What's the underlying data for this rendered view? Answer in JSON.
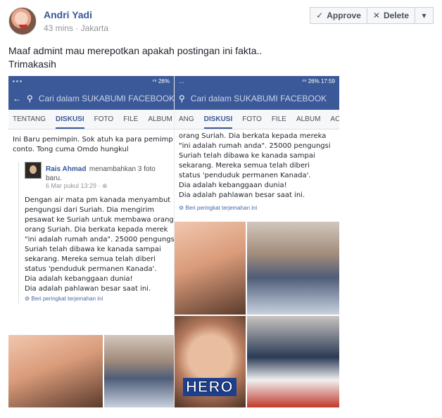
{
  "post": {
    "author": "Andri Yadi",
    "meta": "43 mins · Jakarta",
    "text_line1": "Maaf admint mau merepotkan apakah postingan ini fakta..",
    "text_line2": "Trimakasih"
  },
  "actions": {
    "approve_label": "Approve",
    "delete_label": "Delete"
  },
  "screenshot_left": {
    "status_right": "⁴⁶ 26%",
    "search_placeholder": "Cari dalam SUKABUMI FACEBOOK",
    "tabs": [
      "TENTANG",
      "DISKUSI",
      "FOTO",
      "FILE",
      "ALBUM"
    ],
    "body_line1": "Ini Baru pemimpin. Sok atuh ka para pemimp",
    "body_line2": "conto. Tong cuma Omdo hungkul",
    "sharer_name": "Rais Ahmad",
    "sharer_action": "menambahkan 3 foto",
    "sharer_action2": "baru.",
    "sharer_time": "6 Mar pukul 13:29 · ⊕",
    "quote": [
      "Dengan air mata pm kanada menyambut",
      "pengungsi dari Suriah. Dia mengirim",
      "pesawat ke Suriah untuk membawa orang",
      "orang Suriah. Dia berkata kepada merek",
      "\"ini adalah rumah anda\". 25000 pengungs",
      "Suriah telah dibawa ke kanada sampai",
      "sekarang. Mereka semua telah diberi",
      "status 'penduduk permanen Kanada'.",
      "Dia adalah kebanggaan dunia!",
      "Dia adalah pahlawan besar saat ini."
    ],
    "rate_text": "Beri peringkat terjemahan ini"
  },
  "screenshot_right": {
    "status_right": "⁴⁶ 26% 17:59",
    "search_placeholder": "Cari dalam SUKABUMI FACEBOOK",
    "tabs": [
      "ANG",
      "DISKUSI",
      "FOTO",
      "FILE",
      "ALBUM",
      "AC"
    ],
    "quote": [
      "orang Suriah. Dia berkata kepada mereka",
      "\"ini adalah rumah anda\". 25000 pengungsi",
      "Suriah telah dibawa ke kanada sampai",
      "sekarang. Mereka semua telah diberi",
      "status 'penduduk permanen Kanada'.",
      "Dia adalah kebanggaan dunia!",
      "Dia adalah pahlawan besar saat ini."
    ],
    "rate_text": "Beri peringkat terjemahan ini",
    "hero_text": "HERO"
  },
  "colors": {
    "fb_blue": "#3b5998",
    "link_blue": "#365899"
  }
}
